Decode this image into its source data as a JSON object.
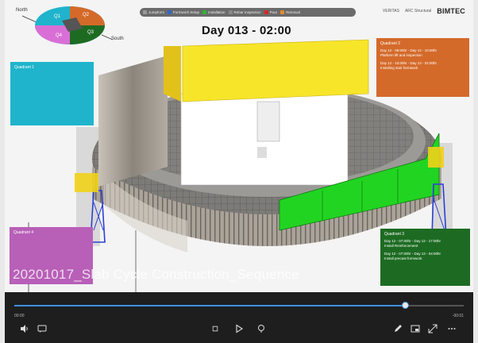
{
  "title": "Day 013 - 02:00",
  "caption": "20201017_Slab Cycle Construction_Sequence",
  "compass": {
    "north_label": "North",
    "south_label": "South",
    "quadrants": [
      {
        "id": "q1",
        "label": "Q1",
        "color": "#1fb4cc"
      },
      {
        "id": "q2",
        "label": "Q2",
        "color": "#d46a2a"
      },
      {
        "id": "q3",
        "label": "Q3",
        "color": "#1d6b22"
      },
      {
        "id": "q4",
        "label": "Q4",
        "color": "#b85fb8"
      }
    ]
  },
  "legend": [
    {
      "label": "Jumpform",
      "color": "#9a9a9a"
    },
    {
      "label": "Formwork Setup",
      "color": "#2f66c8"
    },
    {
      "label": "Installation",
      "color": "#2fb82f"
    },
    {
      "label": "Rebar Inspection",
      "color": "#888888"
    },
    {
      "label": "Pour",
      "color": "#d62828"
    },
    {
      "label": "Removal",
      "color": "#e28b2e"
    }
  ],
  "logos": {
    "partner1": "VERITAS",
    "partner2": "ARC Structural",
    "brand": "BIMTEC"
  },
  "panels": {
    "cyan": {
      "title": "Quadrant 1",
      "lines": []
    },
    "orange": {
      "title": "Quadrant 2",
      "lines": [
        "Day 12 - 08:00hr - Day 12 - 10:00hr",
        "Platform lift and inspection",
        "Day 12 - 10:00hr - Day 13 - 02:00hr",
        "Installing stair formwork"
      ]
    },
    "magenta": {
      "title": "Quadrant 4",
      "lines": []
    },
    "green": {
      "title": "Quadrant 3",
      "lines": [
        "Day 12 - 07:00hr - Day 12 - 17:00hr",
        "Install Reinforcement",
        "Day 12 - 07:00hr - Day 13 - 04:00hr",
        "Install precast formwork"
      ]
    }
  },
  "player": {
    "elapsed": "00:00",
    "remaining": "-00:01",
    "progress": 0.87,
    "buttons": {
      "volume": "volume-icon",
      "subtitles": "subtitles-icon",
      "previous": "previous-icon",
      "play": "play-icon",
      "next": "next-icon",
      "edit": "edit-icon",
      "miniplayer": "miniplayer-icon",
      "fullscreen": "fullscreen-icon",
      "more": "more-icon"
    }
  }
}
